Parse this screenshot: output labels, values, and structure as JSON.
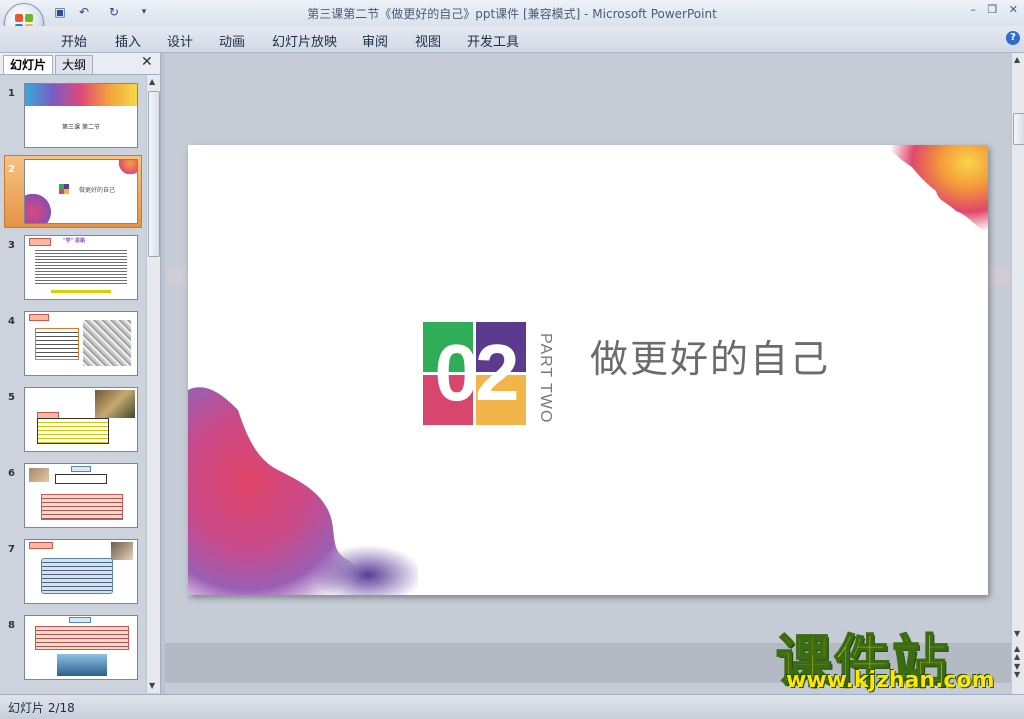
{
  "window": {
    "title": "第三课第二节《做更好的自己》ppt课件 [兼容模式] - Microsoft PowerPoint"
  },
  "ribbon": {
    "tabs": [
      "开始",
      "插入",
      "设计",
      "动画",
      "幻灯片放映",
      "审阅",
      "视图",
      "开发工具"
    ]
  },
  "panel": {
    "tabs": [
      "幻灯片",
      "大纲"
    ],
    "slides": [
      {
        "num": "1",
        "caption": "第三课 第二节"
      },
      {
        "num": "2",
        "caption": "做更好的自己"
      },
      {
        "num": "3",
        "caption": "\"学\" 思路"
      },
      {
        "num": "4",
        "caption": ""
      },
      {
        "num": "5",
        "caption": ""
      },
      {
        "num": "6",
        "caption": ""
      },
      {
        "num": "7",
        "caption": ""
      },
      {
        "num": "8",
        "caption": ""
      }
    ]
  },
  "slide": {
    "number": "02",
    "subtitle": "PART TWO",
    "title": "做更好的自己",
    "block_colors": [
      "#2fae57",
      "#5c3b8f",
      "#d8466d",
      "#f2b54a"
    ]
  },
  "status": {
    "slide_indicator": "幻灯片 2/18"
  },
  "watermark": {
    "name": "课件站",
    "url": "www.kjzhan.com"
  }
}
